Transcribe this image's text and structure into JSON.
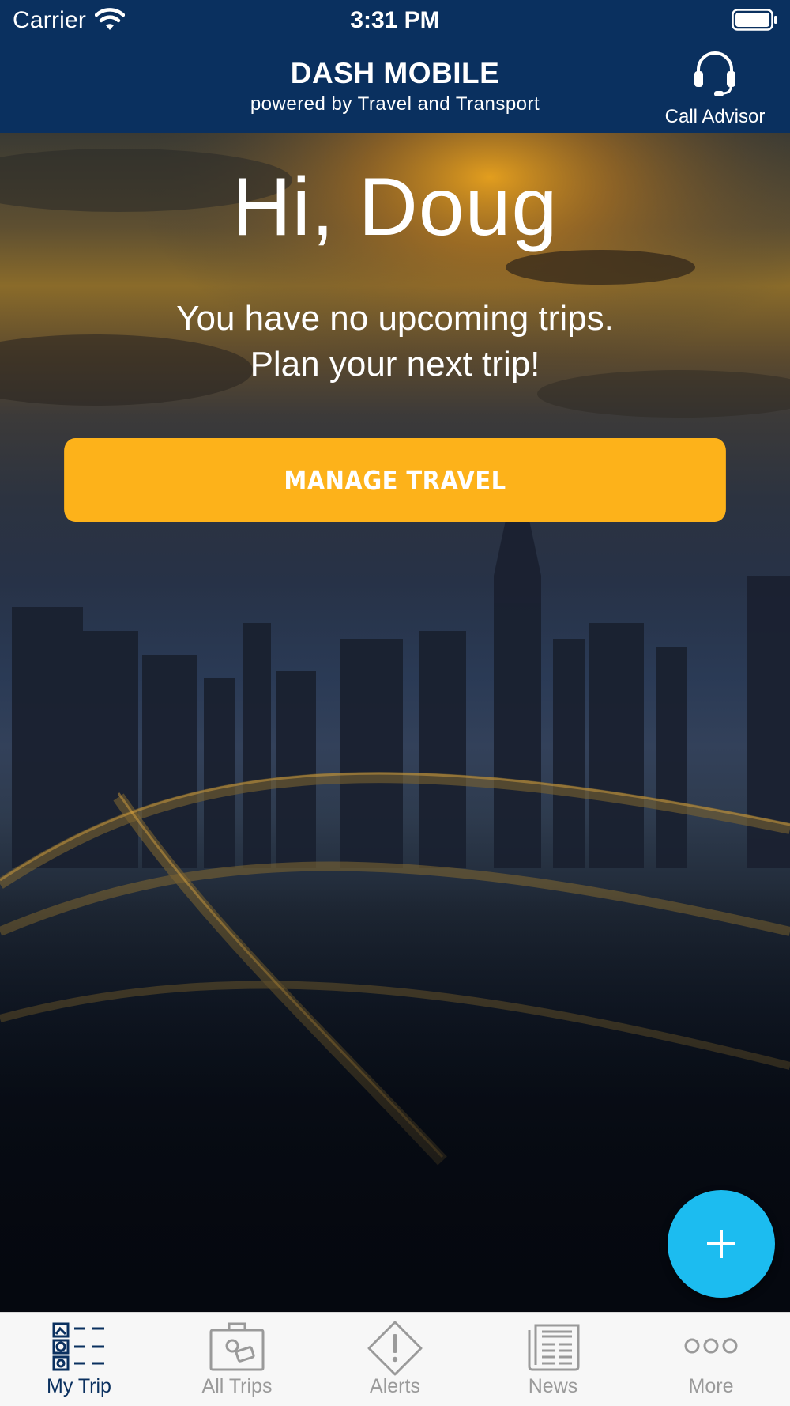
{
  "status_bar": {
    "carrier": "Carrier",
    "time": "3:31 PM"
  },
  "header": {
    "title": "DASH MOBILE",
    "subtitle": "powered by Travel and Transport",
    "call_advisor_label": "Call Advisor",
    "call_advisor_icon": "headset-icon",
    "background_color": "#0a305f"
  },
  "main": {
    "greeting": "Hi, Doug",
    "message_line1": "You have no upcoming trips.",
    "message_line2": "Plan your next trip!",
    "manage_button_label": "MANAGE TRAVEL",
    "manage_button_color": "#fdb21a",
    "fab_icon": "plus-icon",
    "fab_color": "#1cbcf0"
  },
  "tab_bar": {
    "active_color": "#0a305f",
    "inactive_color": "#9a9a9a",
    "tabs": [
      {
        "label": "My Trip",
        "icon": "itinerary-list-icon",
        "active": true
      },
      {
        "label": "All Trips",
        "icon": "suitcase-icon",
        "active": false
      },
      {
        "label": "Alerts",
        "icon": "alert-diamond-icon",
        "active": false
      },
      {
        "label": "News",
        "icon": "newspaper-icon",
        "active": false
      },
      {
        "label": "More",
        "icon": "more-dots-icon",
        "active": false
      }
    ]
  }
}
